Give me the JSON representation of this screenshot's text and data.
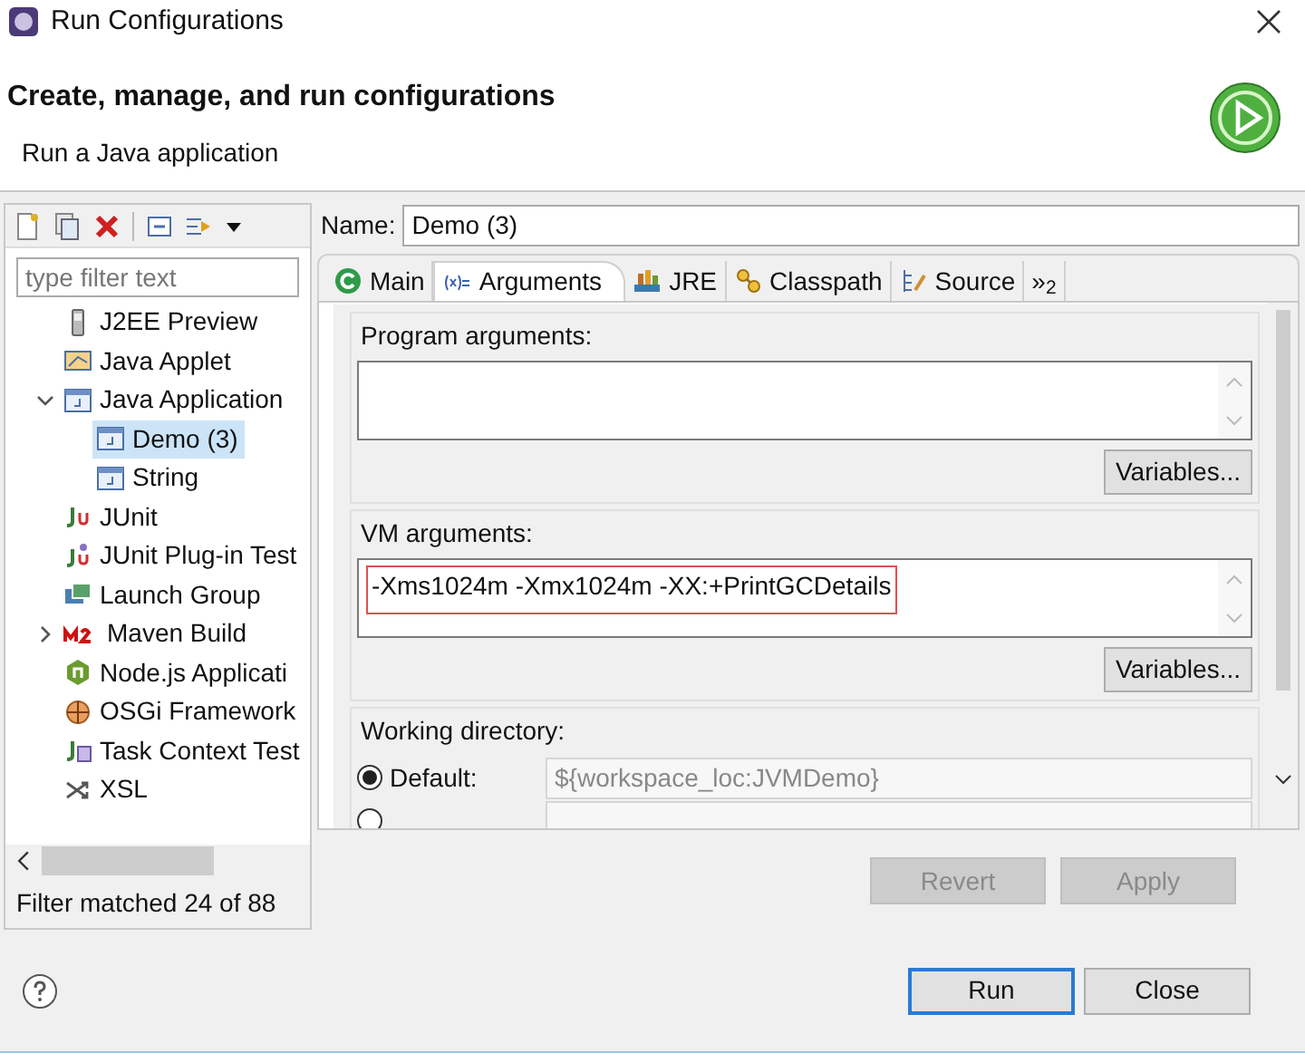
{
  "window": {
    "title": "Run Configurations"
  },
  "header": {
    "title": "Create, manage, and run configurations",
    "subtitle": "Run a Java application"
  },
  "sidebar": {
    "filter_placeholder": "type filter text",
    "tree": [
      {
        "label": "J2EE Preview",
        "kind": "phone",
        "selected": false
      },
      {
        "label": "Java Applet",
        "kind": "applet",
        "selected": false
      },
      {
        "label": "Java Application",
        "kind": "java",
        "selected": false,
        "expanded": true,
        "children": [
          {
            "label": "Demo (3)",
            "kind": "java",
            "selected": true
          },
          {
            "label": "String",
            "kind": "java",
            "selected": false
          }
        ]
      },
      {
        "label": "JUnit",
        "kind": "junit",
        "selected": false
      },
      {
        "label": "JUnit Plug-in Test",
        "kind": "junitplug",
        "selected": false
      },
      {
        "label": "Launch Group",
        "kind": "group",
        "selected": false
      },
      {
        "label": "Maven Build",
        "kind": "maven",
        "selected": false,
        "expanded": false
      },
      {
        "label": "Node.js Applicati",
        "kind": "node",
        "selected": false
      },
      {
        "label": "OSGi Framework",
        "kind": "osgi",
        "selected": false
      },
      {
        "label": "Task Context Test",
        "kind": "task",
        "selected": false
      },
      {
        "label": "XSL",
        "kind": "xsl",
        "selected": false
      }
    ],
    "status": "Filter matched 24 of 88"
  },
  "name_field": {
    "label": "Name:",
    "value": "Demo (3)"
  },
  "tabs": [
    {
      "label": "Main",
      "kind": "main",
      "selected": false
    },
    {
      "label": "Arguments",
      "kind": "args",
      "selected": true
    },
    {
      "label": "JRE",
      "kind": "jre",
      "selected": false
    },
    {
      "label": "Classpath",
      "kind": "classpath",
      "selected": false
    },
    {
      "label": "Source",
      "kind": "source",
      "selected": false
    },
    {
      "label": "»$_{2}$",
      "kind": "more",
      "selected": false
    }
  ],
  "program_arguments": {
    "label": "Program arguments:",
    "button": "Variables..."
  },
  "vm_arguments": {
    "label": "VM arguments:",
    "value": "-Xms1024m -Xmx1024m -XX:+PrintGCDetails",
    "highlighted": true,
    "button": "Variables..."
  },
  "working_directory": {
    "label": "Working directory:",
    "options": [
      {
        "label": "Default:",
        "selected": true,
        "value": "${workspace_loc:JVMDemo}"
      },
      {
        "selected": false
      }
    ]
  },
  "action_buttons": [
    {
      "label": "Revert",
      "disabled": true
    },
    {
      "label": "Apply",
      "disabled": true
    }
  ],
  "footer_buttons": [
    {
      "label": "Run",
      "default": true
    },
    {
      "label": "Close",
      "default": false
    }
  ]
}
